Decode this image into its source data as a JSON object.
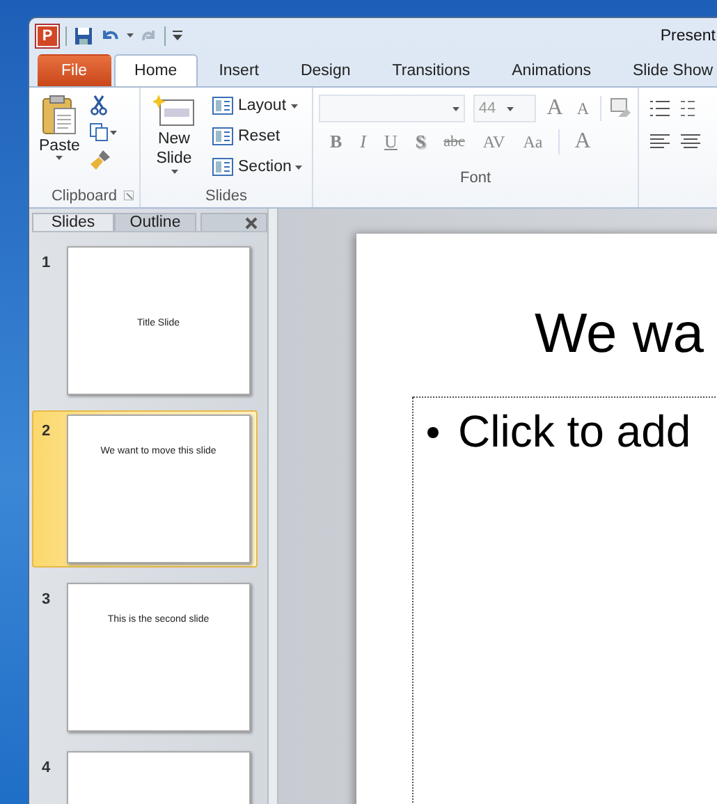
{
  "window": {
    "title": "Present",
    "app_icon": "P"
  },
  "tabs": [
    {
      "label": "File",
      "kind": "file",
      "selected": false
    },
    {
      "label": "Home",
      "kind": "tab",
      "selected": true
    },
    {
      "label": "Insert",
      "kind": "tab",
      "selected": false
    },
    {
      "label": "Design",
      "kind": "tab",
      "selected": false
    },
    {
      "label": "Transitions",
      "kind": "tab",
      "selected": false
    },
    {
      "label": "Animations",
      "kind": "tab",
      "selected": false
    },
    {
      "label": "Slide Show",
      "kind": "tab",
      "selected": false
    }
  ],
  "ribbon": {
    "clipboard": {
      "title": "Clipboard",
      "paste_label": "Paste"
    },
    "slides": {
      "title": "Slides",
      "new_slide_label": "New Slide",
      "commands": [
        {
          "label": "Layout",
          "dropdown": true
        },
        {
          "label": "Reset",
          "dropdown": false
        },
        {
          "label": "Section",
          "dropdown": true
        }
      ]
    },
    "font": {
      "title": "Font",
      "size": "44",
      "size_buttons": [
        "A",
        "A"
      ],
      "format_buttons": [
        "B",
        "I",
        "U",
        "S",
        "abc",
        "AV",
        "Aa"
      ],
      "color_button": "A"
    }
  },
  "panel": {
    "tabs": [
      {
        "label": "Slides",
        "selected": true
      },
      {
        "label": "Outline",
        "selected": false
      }
    ],
    "slides": [
      {
        "number": "1",
        "title": "Title Slide",
        "selected": false
      },
      {
        "number": "2",
        "title": "We want to move this slide",
        "selected": true
      },
      {
        "number": "3",
        "title": "This is the second  slide",
        "selected": false
      },
      {
        "number": "4",
        "selected": false
      }
    ]
  },
  "editor": {
    "title": "We wa",
    "bullet_text": "Click to add"
  }
}
